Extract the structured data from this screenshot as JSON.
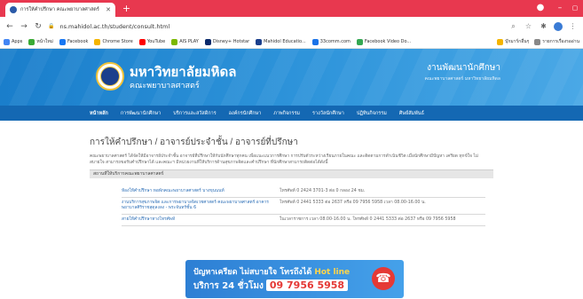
{
  "browser": {
    "tab_title": "การให้คำปรึกษา คณะพยาบาลศาสตร์",
    "url": "ns.mahidol.ac.th/student/consult.html",
    "bookmarks": [
      {
        "label": "Apps",
        "color": "#4285f4"
      },
      {
        "label": "หน้าใหม่",
        "color": "#3aaa35"
      },
      {
        "label": "Facebook",
        "color": "#1877f2"
      },
      {
        "label": "Chrome Store",
        "color": "#f4b400"
      },
      {
        "label": "YouTube",
        "color": "#ff0000"
      },
      {
        "label": "AIS PLAY",
        "color": "#7ab800"
      },
      {
        "label": "Disney+ Hotstar",
        "color": "#0b2a6b"
      },
      {
        "label": "Mahidol Educatio...",
        "color": "#1b3f8c"
      },
      {
        "label": "33comm.com",
        "color": "#1a73e8"
      },
      {
        "label": "Facebook Video Do...",
        "color": "#34a853"
      }
    ],
    "bookmarks_right": [
      {
        "label": "บุ๊กมาร์กอื่นๆ",
        "color": "#f4b400"
      },
      {
        "label": "รายการเรื่องรออ่าน",
        "color": "#888888"
      }
    ]
  },
  "header": {
    "university": "มหาวิทยาลัยมหิดล",
    "faculty": "คณะพยาบาลศาสตร์",
    "department": "งานพัฒนานักศึกษา",
    "department_sub": "คณะพยาบาลศาสตร์ มหาวิทยาลัยมหิดล"
  },
  "nav": [
    {
      "label": "หน้าหลัก",
      "active": true
    },
    {
      "label": "การพัฒนานักศึกษา",
      "active": false
    },
    {
      "label": "บริการและสวัสดิการ",
      "active": false
    },
    {
      "label": "องค์กรนักศึกษา",
      "active": false
    },
    {
      "label": "ภาพกิจกรรม",
      "active": false
    },
    {
      "label": "รางวัลนักศึกษา",
      "active": false
    },
    {
      "label": "ปฏิทินกิจกรรม",
      "active": false
    },
    {
      "label": "ศิษย์สัมพันธ์",
      "active": false
    }
  ],
  "page": {
    "heading": "การให้คำปรึกษา / อาจารย์ประจำชั้น / อาจารย์ที่ปรึกษา",
    "intro": "คณะพยาบาลศาสตร์ ได้จัดให้มีอาจารย์ประจำชั้น อาจารย์ที่ปรึกษาให้กับนักศึกษาทุกคน เพื่อแนะแนวการศึกษา การปรับตัวระหว่างเรียนภายในคณะ และติดตามการดำเนินชีวิต เมื่อนักศึกษามีปัญหา เครียด ทุกข์ใจ ไม่สบายใจ สามารถขอรับคำปรึกษาได้ และคณะฯ มีหน่วยงานที่ให้บริการด้านสุขภาพจิตและคำปรึกษา ที่นักศึกษาสามารถติดต่อได้ดังนี้ ",
    "section_title": "สถานที่ให้บริการคณะพยาบาลศาสตร์",
    "services": [
      {
        "place": "ห้องให้คำปรึกษา หอพักคณะพยาบาลศาสตร์ บางขุนนนท์",
        "contact": "โทรศัพท์ 0 2424 3701-3 ต่อ 0 กลอง 24 ชม."
      },
      {
        "place": "งานบริการสุขภาพจิต และการพยาบาลจิตเวชศาสตร์ คณะพยาบาลศาสตร์ อาคารพยาบาลศิริราชสุดุลงลง - พระจันทร์ชั้น 6",
        "contact": "โทรศัพท์ 0 2441 5333 ต่อ 2637 หรือ 09 7956 5958 เวลา 08.00-16.00 น."
      },
      {
        "place": "สายให้คำปรึกษาทางโทรศัพท์",
        "contact": "ในเวลาราชการ เวลา 08.00-16.00 น. โทรศัพท์ 0 2441 5333 ต่อ 2637 หรือ 09 7956 5958"
      }
    ]
  },
  "banner": {
    "line1": "ปัญหาเครียด ไม่สบายใจ โทรถึงได้",
    "hotline": "Hot line",
    "line2": "บริการ 24 ชั่วโมง",
    "phone": "09 7956 5958"
  }
}
